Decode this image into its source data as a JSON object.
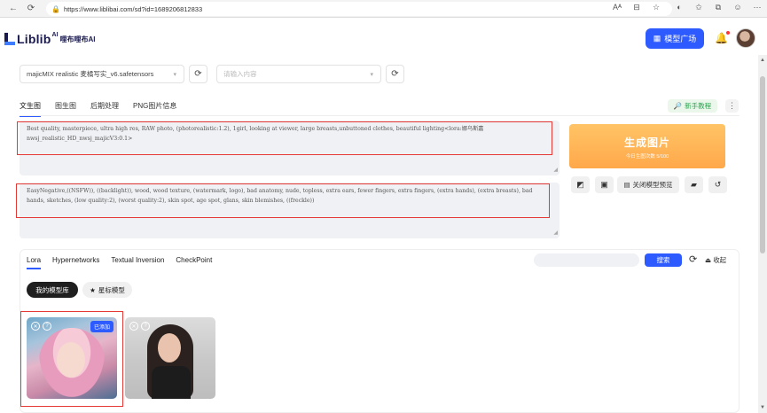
{
  "browser": {
    "url": "https://www.liblibai.com/sd?id=1689206812833",
    "text_size_icon": "Aᴬ"
  },
  "header": {
    "logo_text": "Liblib",
    "logo_ai": "AI",
    "logo_cn": "哩布哩布AI",
    "market_button": "模型广场"
  },
  "toolbar": {
    "model_value": "majicMIX realistic 麦橘写实_v6.safetensors",
    "vae_placeholder": "请输入内容"
  },
  "tabs": [
    "文生图",
    "图生图",
    "后期处理",
    "PNG图片信息"
  ],
  "guide_label": "新手教程",
  "positive_prompt": "Best quality, masterpiece, ultra high res, RAW photo, (photorealistic:1.2), 1girl, looking at viewer, large breasts,unbuttoned clothes, beautiful lighting<lora:娜乌斯嘉nwsj_realistic_HD_nwsj_majicV3:0.1>",
  "negative_prompt": "EasyNegative,((NSFW)), ((backlight)), wood, wood texture, (watermark, logo), bad anatomy, nude, topless, extra ears, fewer fingers, extra fingers, (extra hands), (extra breasts), bad hands, sketches, (low quality:2), (worst quality:2), skin spot, age spot, glans, skin blemishes, ((freckle))",
  "generate": {
    "label": "生成图片",
    "sub": "今日生图次数 5/100"
  },
  "preview_toggle": "关闭模型预览",
  "lora_panel": {
    "tabs": [
      "Lora",
      "Hypernetworks",
      "Textual Inversion",
      "CheckPoint"
    ],
    "search_button": "搜索",
    "collapse_label": "收起",
    "my_models": "我的模型库",
    "starred": "星标模型",
    "added_badge": "已添加"
  },
  "colors": {
    "brand": "#2d5bff",
    "generate": "#ffb255",
    "highlight_box": "#e53935"
  }
}
